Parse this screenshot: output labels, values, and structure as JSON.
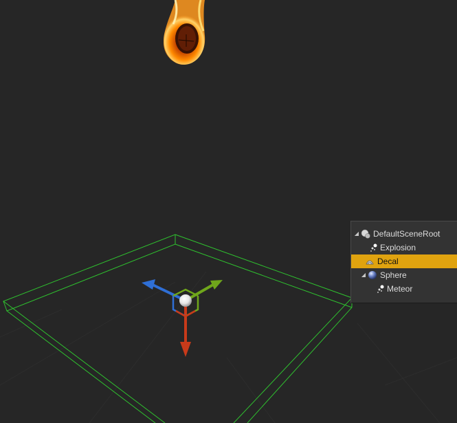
{
  "outliner": {
    "items": [
      {
        "label": "DefaultSceneRoot",
        "icon": "scene-root-icon",
        "expanded": true,
        "depth": 0
      },
      {
        "label": "Explosion",
        "icon": "particle-system-icon",
        "depth": 1
      },
      {
        "label": "Decal",
        "icon": "decal-icon",
        "depth": 0,
        "selected": true
      },
      {
        "label": "Sphere",
        "icon": "sphere-icon",
        "expanded": true,
        "depth": 0
      },
      {
        "label": "Meteor",
        "icon": "particle-system-icon",
        "depth": 1
      }
    ]
  },
  "viewport": {
    "gizmo_axes": {
      "x_color": "#c83a1a",
      "y_color": "#6fa61b",
      "z_color": "#2f6fd6"
    },
    "bounds_color": "#2fc22f",
    "selection_color": "#e0a30f"
  }
}
